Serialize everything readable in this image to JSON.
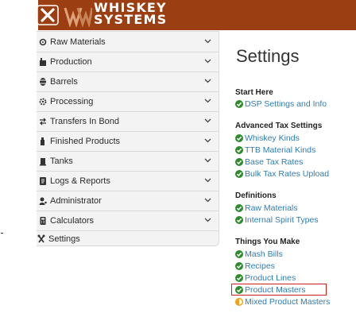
{
  "header": {
    "brand_line1": "WHISKEY",
    "brand_line2": "SYSTEMS",
    "close_icon": "close-icon",
    "logo_icon": "barrel-logo-icon",
    "colors": {
      "bar": "#9b3e12",
      "text": "#ffffff"
    }
  },
  "sidebar": {
    "items": [
      {
        "label": "Raw Materials",
        "icon": "raw-materials-icon"
      },
      {
        "label": "Production",
        "icon": "production-icon"
      },
      {
        "label": "Barrels",
        "icon": "barrel-icon"
      },
      {
        "label": "Processing",
        "icon": "processing-icon"
      },
      {
        "label": "Transfers In Bond",
        "icon": "transfer-icon"
      },
      {
        "label": "Finished Products",
        "icon": "finished-products-icon"
      },
      {
        "label": "Tanks",
        "icon": "tank-icon"
      },
      {
        "label": "Logs & Reports",
        "icon": "logs-icon"
      },
      {
        "label": "Administrator",
        "icon": "administrator-icon"
      },
      {
        "label": "Calculators",
        "icon": "calculator-icon"
      }
    ],
    "settings": {
      "label": "Settings",
      "icon": "settings-icon"
    }
  },
  "main": {
    "title": "Settings",
    "sections": [
      {
        "heading": "Start Here",
        "links": [
          "DSP Settings and Info"
        ]
      },
      {
        "heading": "Advanced Tax Settings",
        "links": [
          "Whiskey Kinds",
          "TTB Material Kinds",
          "Base Tax Rates",
          "Bulk Tax Rates Upload"
        ]
      },
      {
        "heading": "Definitions",
        "links": [
          "Raw Materials",
          "Internal Spirit Types"
        ]
      },
      {
        "heading": "Things You Make",
        "links": [
          "Mash Bills",
          "Recipes",
          "Product Lines",
          "Product Masters",
          "Mixed Product Masters"
        ]
      }
    ],
    "highlighted_link": "Product Masters",
    "status_colors": {
      "complete": "#2e8b2e",
      "partial": "#f0a01c",
      "link": "#2f7cb4",
      "highlight": "#cc1f1f"
    }
  }
}
